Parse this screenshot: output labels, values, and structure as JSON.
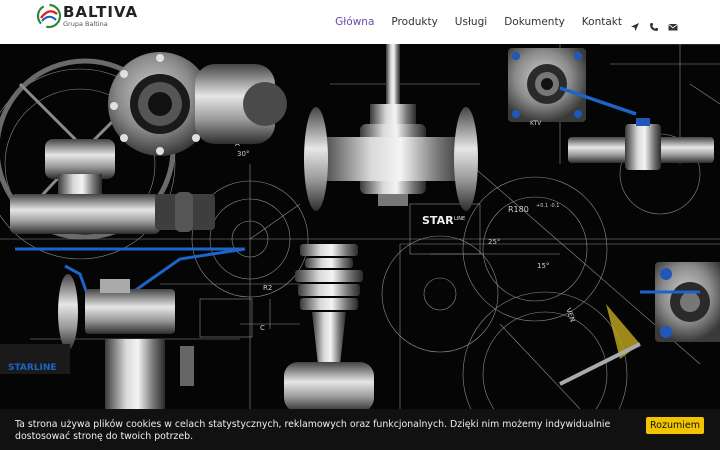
{
  "brand": {
    "name": "BALTIVA",
    "subtitle": "Grupa Baltina"
  },
  "nav": {
    "items": [
      {
        "label": "Główna",
        "active": true
      },
      {
        "label": "Produkty",
        "active": false
      },
      {
        "label": "Usługi",
        "active": false
      },
      {
        "label": "Dokumenty",
        "active": false
      },
      {
        "label": "Kontakt",
        "active": false
      }
    ],
    "icons": [
      "location-arrow-icon",
      "phone-icon",
      "envelope-icon"
    ],
    "active_color": "#6a4ea8"
  },
  "hero": {
    "drawing_labels": {
      "starline": "STAR",
      "starline_sub": "LINE",
      "r180": "R180",
      "tol": "+0.1\n-0.1",
      "a25": "25°",
      "a15": "15°",
      "a30": "30°",
      "r2": "R2",
      "a_mark": "A",
      "c_mark": "C",
      "starline_left": "STARLINE",
      "ktv": "KTV",
      "vent": "VEN"
    },
    "accent_color": "#1e64c8"
  },
  "cookie": {
    "text": "Ta strona używa plików cookies w celach statystycznych, reklamowych oraz funkcjonalnych. Dzięki nim możemy indywidualnie dostosować stronę do twoich potrzeb.",
    "button_label": "Rozumiem",
    "button_color": "#f2c400"
  }
}
